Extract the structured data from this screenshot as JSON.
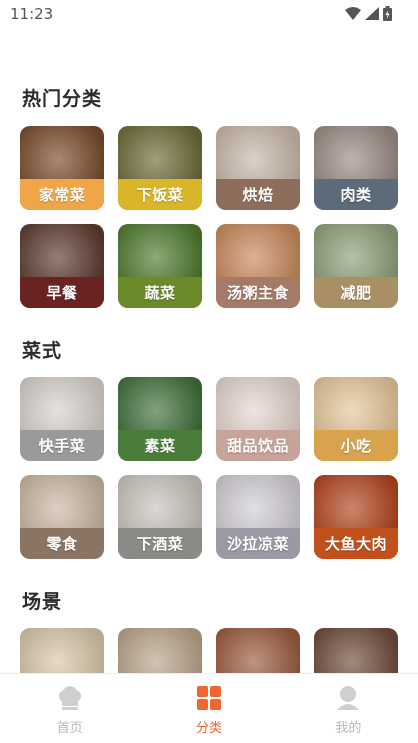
{
  "status_bar": {
    "time": "11:23",
    "icons": [
      "wifi-icon",
      "signal-icon",
      "battery-icon"
    ]
  },
  "sections": [
    {
      "title": "热门分类",
      "items": [
        {
          "label": "家常菜",
          "band_color": "#f0a548",
          "photo_color": "#7a4a2a"
        },
        {
          "label": "下饭菜",
          "band_color": "#d9b52a",
          "photo_color": "#6d6a36"
        },
        {
          "label": "烘焙",
          "band_color": "#8d6e5d",
          "photo_color": "#c9b8aa"
        },
        {
          "label": "肉类",
          "band_color": "#5c6a79",
          "photo_color": "#9b8b83"
        },
        {
          "label": "早餐",
          "band_color": "#6b2322",
          "photo_color": "#5c3a2e"
        },
        {
          "label": "蔬菜",
          "band_color": "#6b8a2a",
          "photo_color": "#4f7a2d"
        },
        {
          "label": "汤粥主食",
          "band_color": "#a57b68",
          "photo_color": "#c9895a"
        },
        {
          "label": "减肥",
          "band_color": "#a89064",
          "photo_color": "#8fa07a"
        }
      ]
    },
    {
      "title": "菜式",
      "items": [
        {
          "label": "快手菜",
          "band_color": "#9a9a9a",
          "photo_color": "#d8d2cc"
        },
        {
          "label": "素菜",
          "band_color": "#4a7d3a",
          "photo_color": "#3f6f3a"
        },
        {
          "label": "甜品饮品",
          "band_color": "#c7a49a",
          "photo_color": "#e6d6cf"
        },
        {
          "label": "小吃",
          "band_color": "#d9a24c",
          "photo_color": "#e7c79a"
        },
        {
          "label": "零食",
          "band_color": "#8a7464",
          "photo_color": "#cbb7a3"
        },
        {
          "label": "下酒菜",
          "band_color": "#8a8a86",
          "photo_color": "#c9c4bd"
        },
        {
          "label": "沙拉凉菜",
          "band_color": "#9a9aa4",
          "photo_color": "#d3cfd6"
        },
        {
          "label": "大鱼大肉",
          "band_color": "#c0501c",
          "photo_color": "#b2441d"
        }
      ]
    },
    {
      "title": "场景",
      "items": [
        {
          "label": "",
          "band_color": "",
          "photo_color": "#d9c7a9"
        },
        {
          "label": "",
          "band_color": "",
          "photo_color": "#b9a48a"
        },
        {
          "label": "",
          "band_color": "",
          "photo_color": "#9b5a3d"
        },
        {
          "label": "",
          "band_color": "",
          "photo_color": "#6f4a3a"
        }
      ]
    }
  ],
  "bottom_nav": [
    {
      "label": "首页",
      "icon": "chef-hat-icon",
      "active": false
    },
    {
      "label": "分类",
      "icon": "category-grid-icon",
      "active": true
    },
    {
      "label": "我的",
      "icon": "person-icon",
      "active": false
    }
  ],
  "colors": {
    "accent": "#f0662f",
    "inactive": "#b8b8b8",
    "title": "#2b2b2b"
  }
}
